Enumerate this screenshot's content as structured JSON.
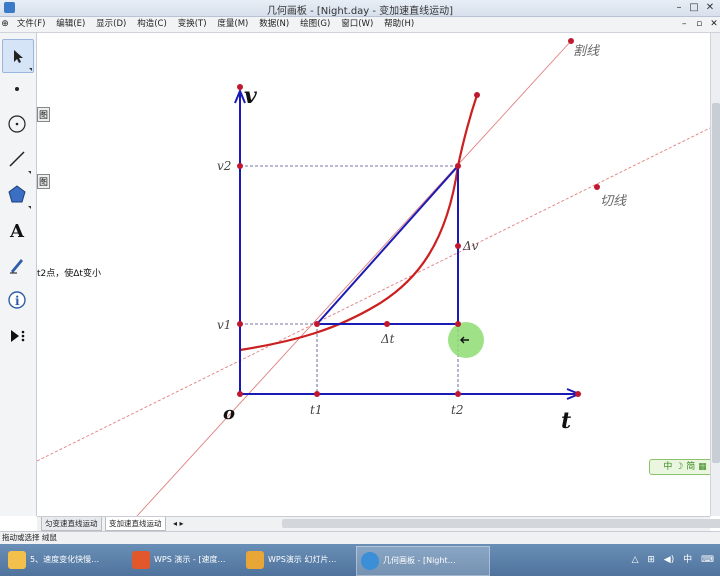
{
  "window": {
    "title": "几何画板 - [Night.day - 变加速直线运动]",
    "min": "–",
    "max": "□",
    "close": "✕"
  },
  "menu": {
    "items": [
      "文件(F)",
      "编辑(E)",
      "显示(D)",
      "构造(C)",
      "变换(T)",
      "度量(M)",
      "数据(N)",
      "绘图(G)",
      "窗口(W)",
      "帮助(H)"
    ],
    "right": [
      "–",
      "▫",
      "✕"
    ]
  },
  "toolbox": {
    "tools": [
      "arrow-tool",
      "point-tool",
      "compass-tool",
      "line-tool",
      "polygon-tool",
      "text-tool",
      "marker-tool",
      "info-tool",
      "custom-tool"
    ]
  },
  "canvas_left_text": {
    "fragment1": "图",
    "fragment2": "图",
    "fragment3": "t2点，使Δt变小"
  },
  "graph": {
    "axis_v_label": "v",
    "axis_t_label": "t",
    "origin_label": "o",
    "v1_label": "v1",
    "v2_label": "v2",
    "t1_label": "t1",
    "t2_label": "t2",
    "dt_label": "Δt",
    "dv_label": "Δv",
    "secant_label": "割线",
    "tangent_label": "切线",
    "colors": {
      "axis": "#1a1ab4",
      "curve": "#cc1f1f",
      "dashed": "#4a4a8a",
      "point": "#c0182e",
      "highlight": "#7fd36a"
    }
  },
  "pages": {
    "tab1": "匀变速直线运动",
    "tab2": "变加速直线运动",
    "nav": "◂ ▸"
  },
  "status": {
    "text": "拖动或选择 绒鼠"
  },
  "watermark": {
    "text": "中 ☽ 简 ▦"
  },
  "taskbar": {
    "items": [
      "5、速度变化快慢…",
      "WPS 演示 - [速度…",
      "WPS演示 幻灯片…",
      "几何画板 - [Night…"
    ],
    "tray": [
      "△",
      "⊞",
      "◀)",
      "中",
      "⌨"
    ]
  }
}
